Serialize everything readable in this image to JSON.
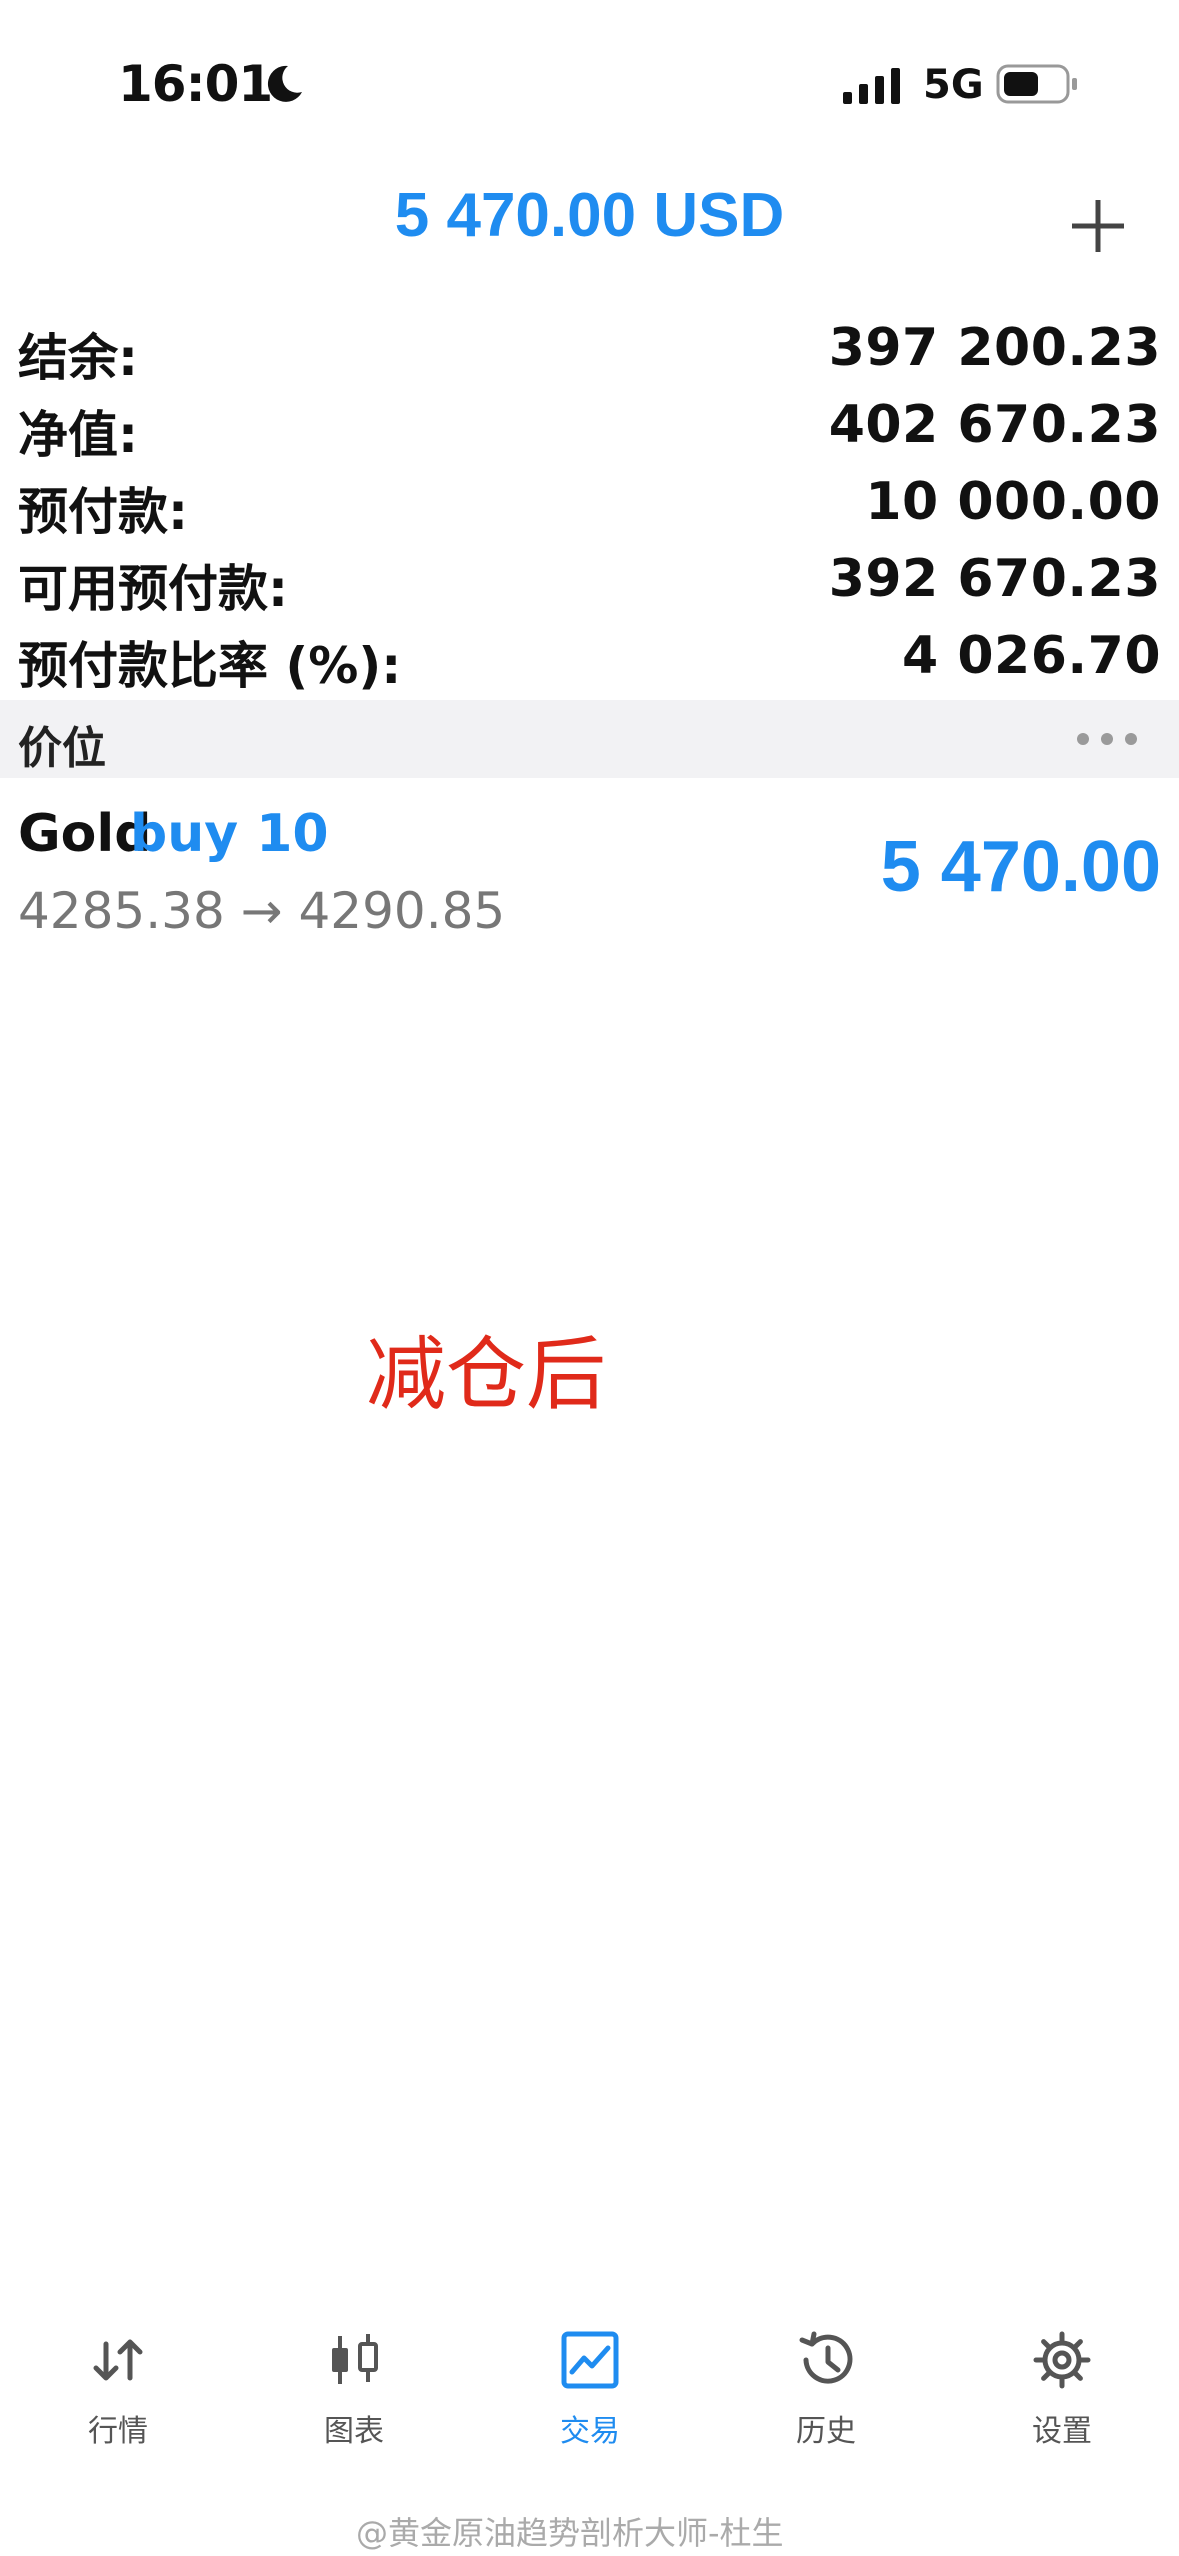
{
  "status_bar": {
    "time": "16:01",
    "network": "5G"
  },
  "header": {
    "title": "5 470.00 USD"
  },
  "summary": [
    {
      "label": "结余:",
      "value": "397 200.23"
    },
    {
      "label": "净值:",
      "value": "402 670.23"
    },
    {
      "label": "预付款:",
      "value": "10 000.00"
    },
    {
      "label": "可用预付款:",
      "value": "392 670.23"
    },
    {
      "label": "预付款比率 (%):",
      "value": "4 026.70"
    }
  ],
  "positions_section": {
    "title": "价位"
  },
  "positions": [
    {
      "symbol": "Gold",
      "side": "buy 10",
      "prices": "4285.38 → 4290.85",
      "profit": "5 470.00"
    }
  ],
  "annotation": "减仓后",
  "tabs": [
    {
      "label": "行情",
      "icon": "quotes-arrows-icon",
      "active": false
    },
    {
      "label": "图表",
      "icon": "candlestick-chart-icon",
      "active": false
    },
    {
      "label": "交易",
      "icon": "trade-chart-icon",
      "active": true
    },
    {
      "label": "历史",
      "icon": "history-clock-icon",
      "active": false
    },
    {
      "label": "设置",
      "icon": "settings-gear-icon",
      "active": false
    }
  ],
  "watermark": "@黄金原油趋势剖析大师-杜生",
  "colors": {
    "accent": "#1f8cf0",
    "annotation": "#e02a1a",
    "section_bg": "#f2f2f4"
  }
}
